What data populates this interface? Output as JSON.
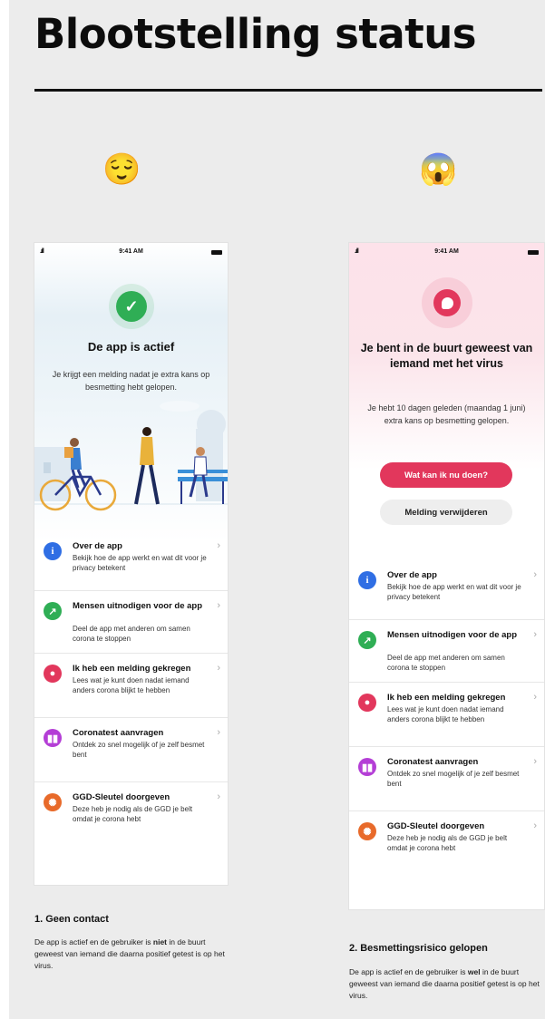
{
  "page": {
    "title": "Blootstelling status"
  },
  "colors": {
    "green": "#2fae55",
    "red": "#e2375c",
    "blue": "#2f6ee4",
    "purple": "#b43ed6",
    "orange": "#e86a2a"
  },
  "columns": [
    {
      "emoji": "😌",
      "status_time": "9:41 AM",
      "headline": "De app is actief",
      "subtitle": "Je krijgt een melding nadat je extra kans op besmetting hebt gelopen.",
      "caption_title": "1. Geen contact",
      "caption_text_before": "De app is actief en de gebruiker is ",
      "caption_emphasis": "niet",
      "caption_text_after": " in de buurt geweest van iemand die daarna positief getest is op het virus."
    },
    {
      "emoji": "😱",
      "status_time": "9:41 AM",
      "headline": "Je bent in de buurt geweest van iemand met het virus",
      "subtitle": "Je hebt 10 dagen geleden (maandag 1 juni) extra kans op besmetting gelopen.",
      "primary_button": "Wat kan ik nu doen?",
      "secondary_button": "Melding verwijderen",
      "caption_title": "2. Besmettingsrisico gelopen",
      "caption_text_before": "De app is actief en de gebruiker is ",
      "caption_emphasis": "wel",
      "caption_text_after": " in de buurt geweest van iemand die daarna positief getest is op het virus."
    }
  ],
  "menu": [
    {
      "title": "Over de app",
      "desc": "Bekijk hoe de app werkt en wat dit voor je privacy betekent",
      "icon": "info-icon"
    },
    {
      "title": "Mensen uitnodigen voor de app",
      "desc": "Deel de app met anderen om samen corona te stoppen",
      "icon": "share-icon"
    },
    {
      "title": "Ik heb een melding gekregen",
      "desc": "Lees wat je kunt doen nadat iemand anders corona blijkt te hebben",
      "icon": "notification-icon"
    },
    {
      "title": "Coronatest aanvragen",
      "desc": "Ontdek zo snel mogelijk of je zelf besmet bent",
      "icon": "test-tube-icon"
    },
    {
      "title": "GGD-Sleutel doorgeven",
      "desc": "Deze heb je nodig als de GGD je belt omdat je corona hebt",
      "icon": "virus-icon"
    }
  ]
}
